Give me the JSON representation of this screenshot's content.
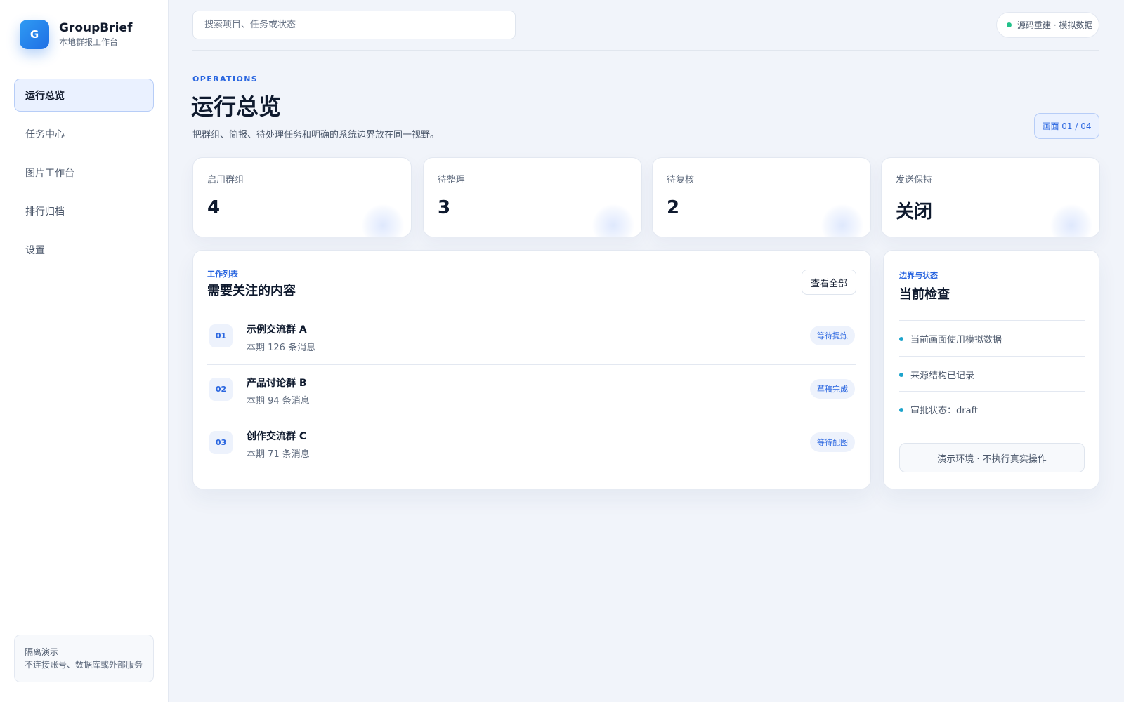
{
  "brand": {
    "logo_letter": "G",
    "name": "GroupBrief",
    "subtitle": "本地群报工作台"
  },
  "sidebar": {
    "items": [
      {
        "label": "运行总览",
        "active": true
      },
      {
        "label": "任务中心",
        "active": false
      },
      {
        "label": "图片工作台",
        "active": false
      },
      {
        "label": "排行归档",
        "active": false
      },
      {
        "label": "设置",
        "active": false
      }
    ],
    "footer": {
      "title": "隔离演示",
      "description": "不连接账号、数据库或外部服务"
    }
  },
  "topbar": {
    "search_placeholder": "搜索项目、任务或状态",
    "search_value": "",
    "source_status": "源码重建 · 模拟数据",
    "source_status_color": "#22c18a"
  },
  "header": {
    "eyebrow": "OPERATIONS",
    "title": "运行总览",
    "description": "把群组、简报、待处理任务和明确的系统边界放在同一视野。",
    "screen_indicator": "画面 01 / 04"
  },
  "stats": [
    {
      "label": "启用群组",
      "value": "4"
    },
    {
      "label": "待整理",
      "value": "3"
    },
    {
      "label": "待复核",
      "value": "2"
    },
    {
      "label": "发送保持",
      "value": "关闭"
    }
  ],
  "work_list": {
    "eyebrow": "工作列表",
    "title": "需要关注的内容",
    "view_all_label": "查看全部",
    "rows": [
      {
        "num": "01",
        "name": "示例交流群 A",
        "meta": "本期 126 条消息",
        "status": "等待提炼"
      },
      {
        "num": "02",
        "name": "产品讨论群 B",
        "meta": "本期 94 条消息",
        "status": "草稿完成"
      },
      {
        "num": "03",
        "name": "创作交流群 C",
        "meta": "本期 71 条消息",
        "status": "等待配图"
      }
    ]
  },
  "checks": {
    "eyebrow": "边界与状态",
    "title": "当前检查",
    "items": [
      "当前画面使用模拟数据",
      "来源结构已记录",
      "审批状态：draft"
    ],
    "demo_button_label": "演示环境 · 不执行真实操作"
  },
  "colors": {
    "accent": "#2a66e0",
    "background": "#f1f4fa",
    "active_nav_bg": "#eaf1ff",
    "check_dot": "#1da4cc"
  }
}
